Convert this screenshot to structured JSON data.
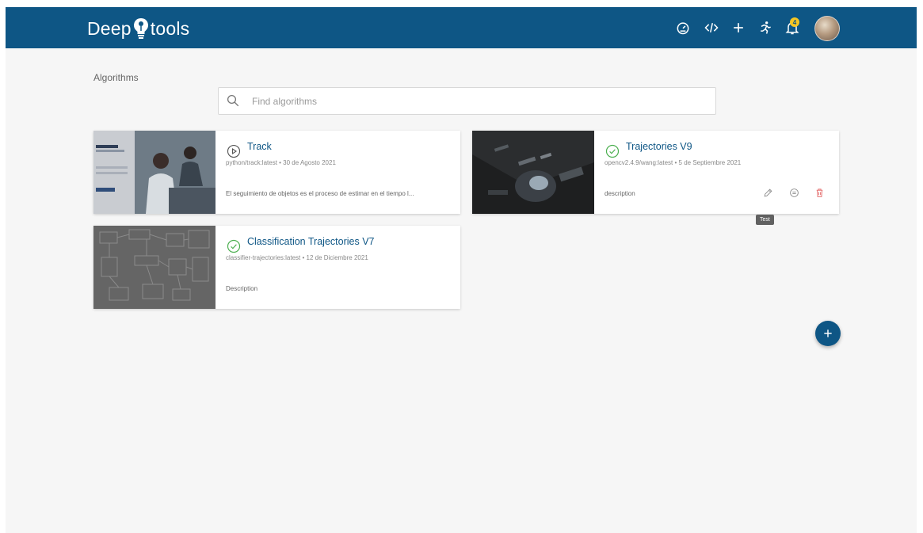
{
  "header": {
    "brand_part1": "Deep",
    "brand_part2": "tools",
    "notification_count": "4",
    "actions": [
      "dashboard-icon",
      "code-icon",
      "add-icon",
      "runner-icon",
      "bell-icon"
    ]
  },
  "breadcrumb": "Algorithms",
  "search": {
    "placeholder": "Find algorithms",
    "value": ""
  },
  "cards": [
    {
      "title": "Track",
      "meta": "python/track:latest  •  30 de Agosto 2021",
      "description": "El seguimiento de objetos es el proceso de estimar en el tiempo l...",
      "status": "play-circle-icon"
    },
    {
      "title": "Trajectories V9",
      "meta": "opencv2.4.9/wang:latest  •  5 de Septiembre 2021",
      "description": "description",
      "status": "check-circle-icon",
      "tools": [
        "edit-icon",
        "test-icon",
        "delete-icon"
      ]
    },
    {
      "title": "Classification Trajectories V7",
      "meta": "classifier-trajectories:latest  •  12 de Diciembre 2021",
      "description": "Description",
      "status": "check-circle-icon"
    }
  ],
  "tooltip": "Test",
  "colors": {
    "primary": "#0e5685",
    "success": "#4caf50",
    "danger": "#e57373",
    "background": "#f6f6f6"
  }
}
